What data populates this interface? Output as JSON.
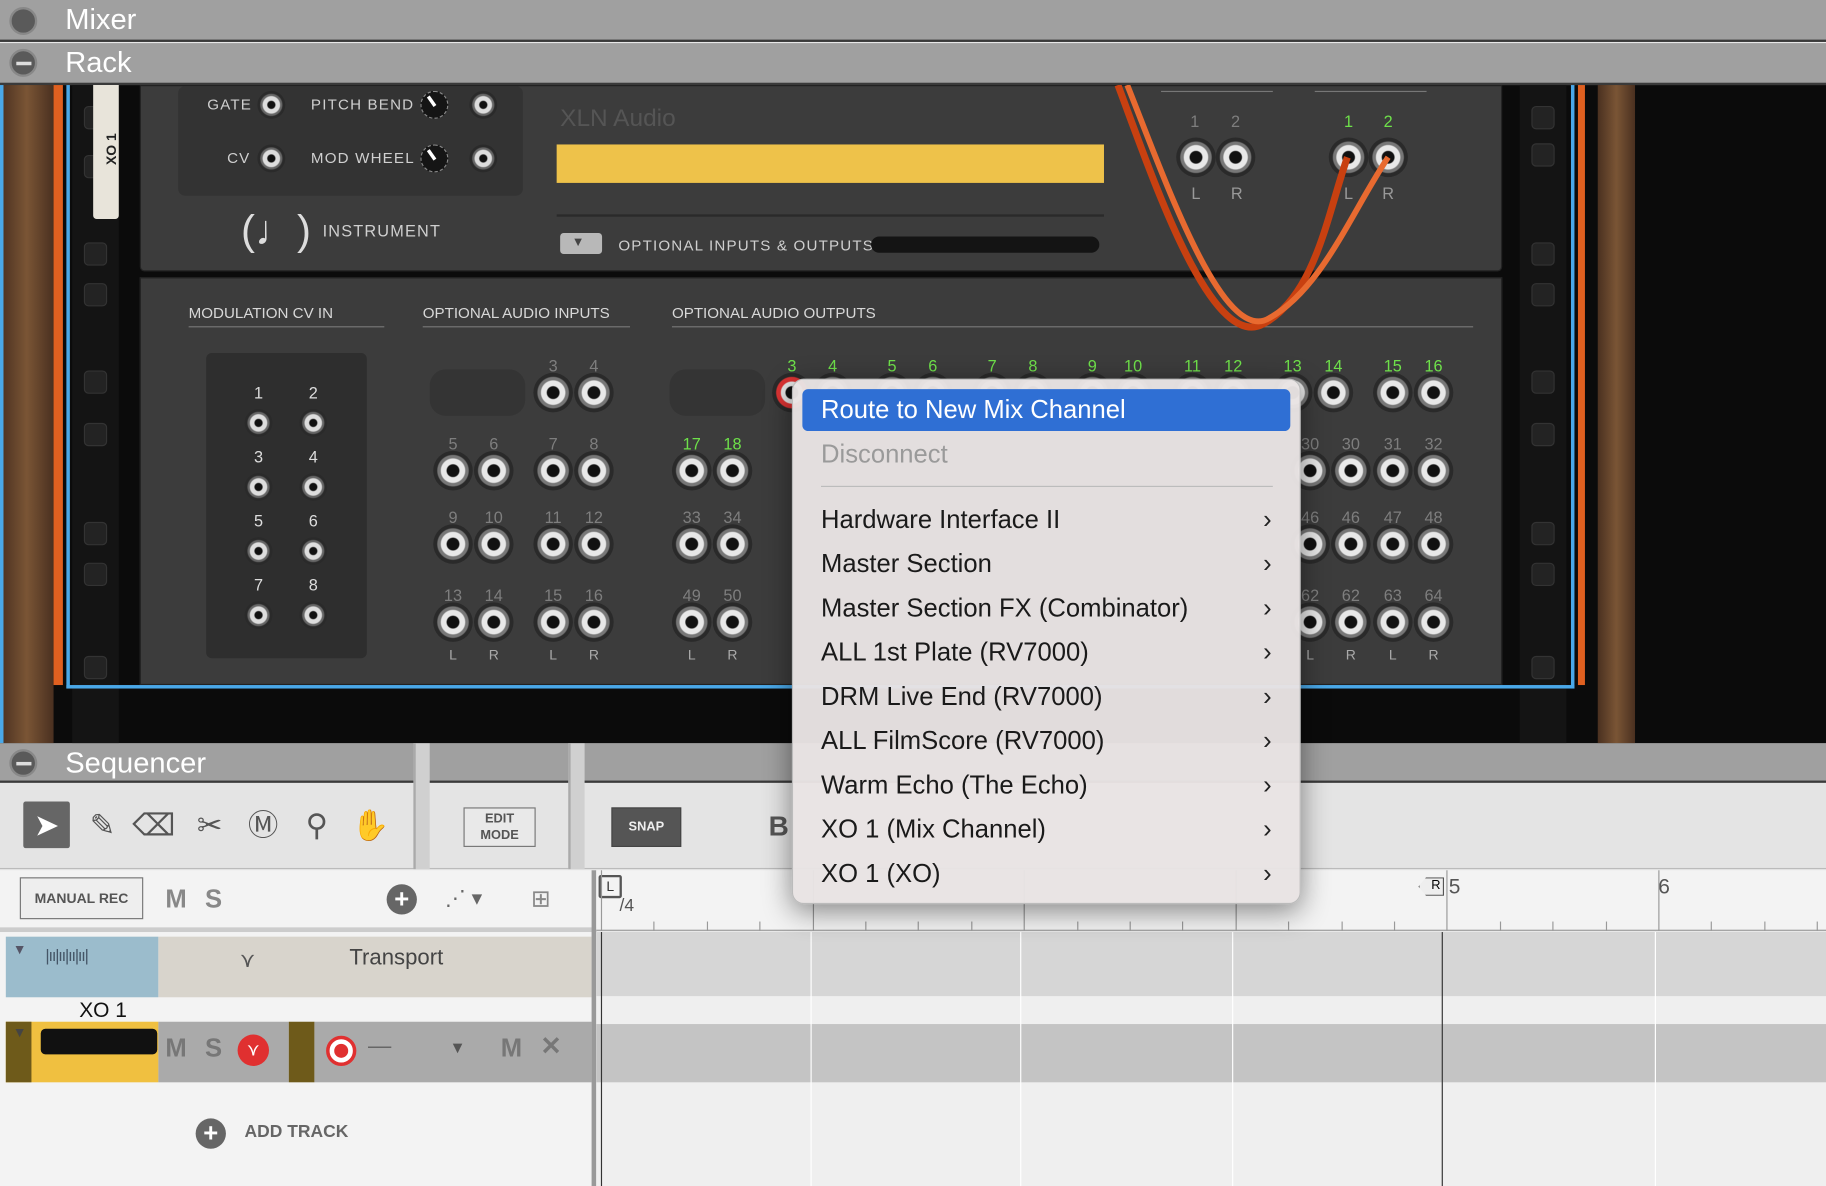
{
  "panels": {
    "mixer": "Mixer",
    "rack": "Rack",
    "sequencer": "Sequencer"
  },
  "device": {
    "tape_label": "XO 1",
    "brand": "XLN Audio",
    "gate": "GATE",
    "cv": "CV",
    "pitch_bend": "PITCH BEND",
    "mod_wheel": "MOD WHEEL",
    "instrument": "INSTRUMENT",
    "optional_io": "OPTIONAL INPUTS & OUTPUTS",
    "out_main": {
      "nums": [
        "1",
        "2"
      ],
      "lr": [
        "L",
        "R"
      ]
    },
    "out_main_connected": {
      "nums": [
        "1",
        "2"
      ],
      "lr": [
        "L",
        "R"
      ]
    }
  },
  "back_panel": {
    "mod_cv_in": "MODULATION CV IN",
    "opt_audio_in": "OPTIONAL AUDIO INPUTS",
    "opt_audio_out": "OPTIONAL AUDIO OUTPUTS",
    "cv_nums": [
      "1",
      "2",
      "3",
      "4",
      "5",
      "6",
      "7",
      "8"
    ],
    "in_row1": [
      "3",
      "4"
    ],
    "in_row2": [
      "5",
      "6",
      "7",
      "8"
    ],
    "in_row3": [
      "9",
      "10",
      "11",
      "12"
    ],
    "in_row4": [
      "13",
      "14",
      "15",
      "16"
    ],
    "out_row1": [
      "3",
      "4",
      "5",
      "6",
      "7",
      "8",
      "9",
      "10",
      "11",
      "12",
      "13",
      "14",
      "15",
      "16"
    ],
    "out_row2_left": [
      "17",
      "18"
    ],
    "out_row2_right": [
      "30",
      "31",
      "32"
    ],
    "out_row3_left": [
      "33",
      "34"
    ],
    "out_row3_right": [
      "46",
      "47",
      "48"
    ],
    "out_row4_left": [
      "49",
      "50"
    ],
    "out_row4_right": [
      "62",
      "63",
      "64"
    ],
    "lr": [
      "L",
      "R"
    ]
  },
  "toolbar": {
    "edit_mode": "EDIT\nMODE",
    "snap": "SNAP",
    "partial": "B"
  },
  "track_header": {
    "manual_rec": "MANUAL REC",
    "m": "M",
    "s": "S"
  },
  "tracks": {
    "transport": "Transport",
    "xo1_name": "XO 1",
    "m": "M",
    "s": "S",
    "dash": "—",
    "m2": "M",
    "x": "✕",
    "add_track": "ADD TRACK"
  },
  "ruler": {
    "sig": "/4",
    "bar5": "5",
    "bar6": "6",
    "r_marker": "R",
    "l_marker": "L"
  },
  "context_menu": {
    "items": [
      {
        "label": "Route to New Mix Channel",
        "state": "highlighted"
      },
      {
        "label": "Disconnect",
        "state": "disabled"
      },
      {
        "label": "Hardware Interface II",
        "submenu": true
      },
      {
        "label": "Master Section",
        "submenu": true
      },
      {
        "label": "Master Section FX (Combinator)",
        "submenu": true
      },
      {
        "label": "ALL 1st Plate (RV7000)",
        "submenu": true
      },
      {
        "label": "DRM Live End (RV7000)",
        "submenu": true
      },
      {
        "label": "ALL FilmScore (RV7000)",
        "submenu": true
      },
      {
        "label": "Warm Echo (The Echo)",
        "submenu": true
      },
      {
        "label": "XO 1 (Mix Channel)",
        "submenu": true
      },
      {
        "label": "XO 1 (XO)",
        "submenu": true
      }
    ],
    "chevron": "›"
  },
  "colors": {
    "accent_blue": "#2f6fd4",
    "green_label": "#6ee04a",
    "track_yellow": "#f0c040",
    "selection_outline": "#4aa8e8"
  }
}
